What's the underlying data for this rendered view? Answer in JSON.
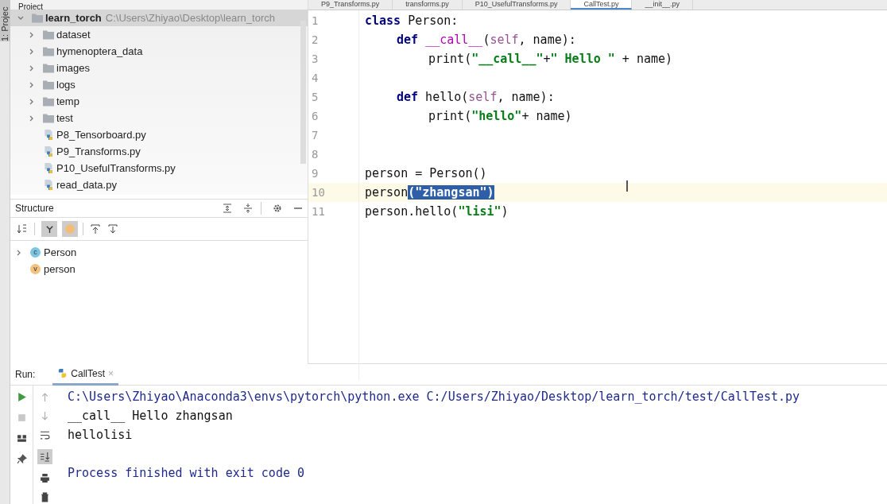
{
  "side_strip": {
    "label": "1: Projec"
  },
  "project_header": {
    "title": "Project"
  },
  "project_tree": {
    "root": {
      "name": "learn_torch",
      "path": "C:\\Users\\Zhiyao\\Desktop\\learn_torch",
      "expanded": true
    },
    "children": [
      {
        "name": "dataset",
        "kind": "folder"
      },
      {
        "name": "hymenoptera_data",
        "kind": "folder"
      },
      {
        "name": "images",
        "kind": "folder"
      },
      {
        "name": "logs",
        "kind": "folder"
      },
      {
        "name": "temp",
        "kind": "folder"
      },
      {
        "name": "test",
        "kind": "folder"
      },
      {
        "name": "P8_Tensorboard.py",
        "kind": "file"
      },
      {
        "name": "P9_Transforms.py",
        "kind": "file"
      },
      {
        "name": "P10_UsefulTransforms.py",
        "kind": "file"
      },
      {
        "name": "read_data.py",
        "kind": "file"
      }
    ]
  },
  "structure": {
    "title": "Structure",
    "items": [
      {
        "name": "Person",
        "kind": "class",
        "badge": "c",
        "expandable": true
      },
      {
        "name": "person",
        "kind": "variable",
        "badge": "v",
        "expandable": false
      }
    ]
  },
  "editor_tabs": [
    {
      "label": "P9_Transforms.py",
      "selected": false
    },
    {
      "label": "transforms.py",
      "selected": false
    },
    {
      "label": "P10_UsefulTransforms.py",
      "selected": false
    },
    {
      "label": "CallTest.py",
      "selected": true
    },
    {
      "label": "__init__.py",
      "selected": false
    }
  ],
  "code_lines": [
    {
      "number": "1",
      "current": false,
      "kind": "top",
      "tokens": [
        {
          "text": "class",
          "kind": "kw"
        },
        {
          "text": " Person:",
          "kind": "plain"
        }
      ]
    },
    {
      "number": "2",
      "current": false,
      "kind": "member",
      "tokens": [
        {
          "text": "def ",
          "kind": "kw"
        },
        {
          "text": "__call__",
          "kind": "magic"
        },
        {
          "text": "(",
          "kind": "plain"
        },
        {
          "text": "self",
          "kind": "self"
        },
        {
          "text": ", name):",
          "kind": "plain"
        }
      ]
    },
    {
      "number": "3",
      "current": false,
      "kind": "body",
      "tokens": [
        {
          "text": "print(",
          "kind": "plain"
        },
        {
          "text": "\"__call__\"",
          "kind": "str"
        },
        {
          "text": "+",
          "kind": "plain"
        },
        {
          "text": "\" Hello \"",
          "kind": "str"
        },
        {
          "text": " + name)",
          "kind": "plain"
        }
      ]
    },
    {
      "number": "4",
      "current": false
    },
    {
      "number": "5",
      "current": false,
      "kind": "member",
      "tokens": [
        {
          "text": "def",
          "kind": "kw"
        },
        {
          "text": " hello(",
          "kind": "plain"
        },
        {
          "text": "self",
          "kind": "self"
        },
        {
          "text": ", name):",
          "kind": "plain"
        }
      ]
    },
    {
      "number": "6",
      "current": false,
      "kind": "body",
      "tokens": [
        {
          "text": "print(",
          "kind": "plain"
        },
        {
          "text": "\"hello\"",
          "kind": "str"
        },
        {
          "text": "+ name)",
          "kind": "plain"
        }
      ]
    },
    {
      "number": "7",
      "current": false
    },
    {
      "number": "8",
      "current": false
    },
    {
      "number": "9",
      "current": false,
      "kind": "top",
      "tokens": [
        {
          "text": "person = Person()",
          "kind": "plain"
        }
      ]
    },
    {
      "number": "10",
      "current": true,
      "kind": "top",
      "tokens": [
        {
          "text": "person",
          "kind": "plain"
        },
        {
          "text": "(\"zhangsan\")",
          "kind": "selected"
        }
      ]
    },
    {
      "number": "11",
      "current": false,
      "kind": "top",
      "tokens": [
        {
          "text": "person.hello(",
          "kind": "plain"
        },
        {
          "text": "\"lisi\"",
          "kind": "str"
        },
        {
          "text": ")",
          "kind": "plain"
        }
      ]
    }
  ],
  "run_panel": {
    "label": "Run:",
    "tab": "CallTest",
    "tab_close": "×",
    "output": [
      {
        "text": "C:\\Users\\Zhiyao\\Anaconda3\\envs\\pytorch\\python.exe C:/Users/Zhiyao/Desktop/learn_torch/test/CallTest.py",
        "kind": "system"
      },
      {
        "text": "__call__ Hello zhangsan",
        "kind": "stdout"
      },
      {
        "text": "hellolisi",
        "kind": "stdout"
      },
      {
        "kind": "blank"
      },
      {
        "text": "Process finished with exit code 0",
        "kind": "system"
      }
    ]
  }
}
